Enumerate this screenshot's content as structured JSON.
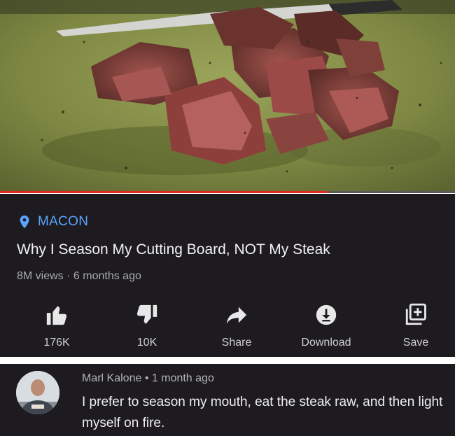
{
  "video": {
    "progress_fraction": 0.72,
    "channel": "MACON",
    "title": "Why I Season My Cutting Board, NOT My Steak",
    "views": "8M views",
    "meta_separator": "·",
    "age": "6 months ago"
  },
  "actions": [
    {
      "icon": "thumbs-up-icon",
      "label": "176K"
    },
    {
      "icon": "thumbs-down-icon",
      "label": "10K"
    },
    {
      "icon": "share-icon",
      "label": "Share"
    },
    {
      "icon": "download-icon",
      "label": "Download"
    },
    {
      "icon": "save-to-playlist-icon",
      "label": "Save"
    }
  ],
  "comment": {
    "author": "Marl Kalone",
    "separator": "•",
    "age": "1 month ago",
    "text": "I prefer to season my mouth, eat the steak raw, and then light myself on fire."
  },
  "colors": {
    "panel_bg": "#1d1b1f",
    "channel_accent": "#5aa5ff",
    "progress_red": "#e12a1f",
    "icon_color": "#e8e8e8"
  }
}
